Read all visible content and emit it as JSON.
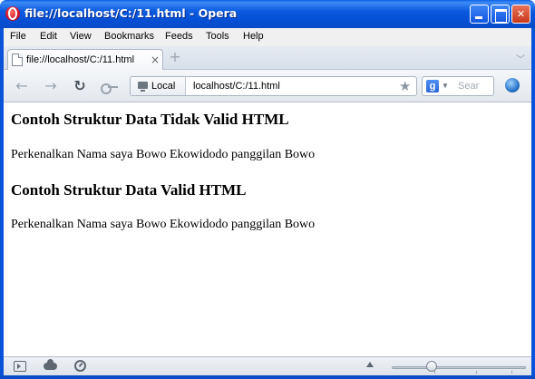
{
  "window": {
    "title": "file://localhost/C:/11.html - Opera"
  },
  "menubar": {
    "items": [
      "File",
      "Edit",
      "View",
      "Bookmarks",
      "Feeds",
      "Tools",
      "Help"
    ]
  },
  "tabs": [
    {
      "label": "file://localhost/C:/11.html",
      "close": "×"
    }
  ],
  "tabstrip": {
    "new_tab": "+"
  },
  "address": {
    "security_label": "Local",
    "url": "localhost/C:/11.html",
    "star": "★"
  },
  "search": {
    "engine_letter": "g",
    "placeholder": "Sear"
  },
  "page": {
    "heading_invalid": "Contoh Struktur Data Tidak Valid HTML",
    "text_invalid": "Perkenalkan Nama saya Bowo Ekowidodo panggilan Bowo",
    "heading_valid": "Contoh Struktur Data Valid HTML",
    "text_valid": "Perkenalkan Nama saya Bowo Ekowidodo panggilan Bowo"
  },
  "statusbar": {
    "zoom_fraction": 0.3
  },
  "colors": {
    "titlebar": "#0a5ae0",
    "close_button": "#c8381a",
    "opera_red": "#c8102e"
  },
  "icons": [
    "opera-logo-icon",
    "minimize-icon",
    "maximize-icon",
    "close-icon",
    "page-icon",
    "tab-close-icon",
    "new-tab-icon",
    "back-icon",
    "forward-icon",
    "reload-icon",
    "key-icon",
    "monitor-icon",
    "star-icon",
    "google-icon",
    "search-engine-icon",
    "panel-toggle-icon",
    "cloud-icon",
    "speed-dial-icon",
    "arrow-up-icon"
  ]
}
